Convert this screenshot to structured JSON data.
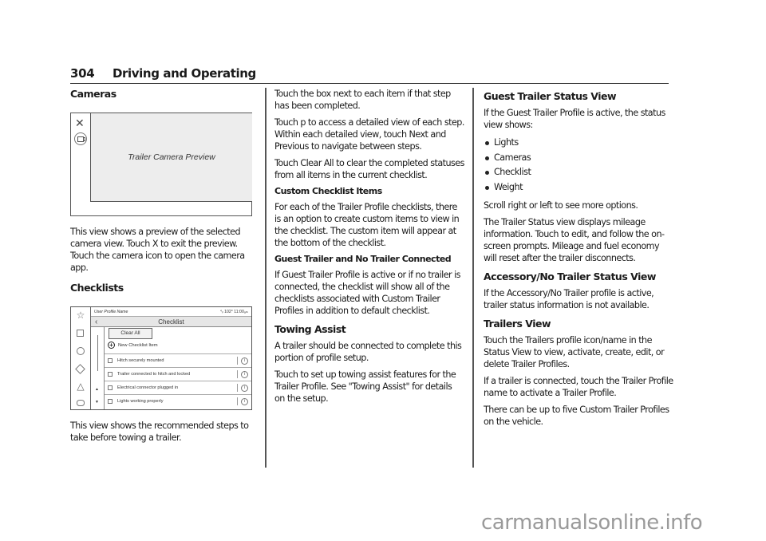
{
  "header": {
    "page_number": "304",
    "section": "Driving and Operating"
  },
  "column1": {
    "cameras_heading": "Cameras",
    "camera_figure": {
      "close_icon": "✕",
      "preview_label": "Trailer Camera Preview"
    },
    "cameras_text": "This view shows a preview of the selected camera view. Touch X to exit the preview. Touch the camera icon to open the camera app.",
    "checklists_heading": "Checklists",
    "checklist_figure": {
      "profile_name": "User Profile Name",
      "status": "⁴ᵢₗ  102°  11:00ₐₘ",
      "back_icon": "‹",
      "title": "Checklist",
      "clear_all": "Clear All",
      "new_item": "New Checklist Item",
      "items": [
        "Hitch securely mounted",
        "Trailer connected to hitch and locked",
        "Electrical connector plugged in",
        "Lights working properly"
      ],
      "side_icons": [
        "star-icon",
        "square-icon",
        "circle-icon",
        "diamond-icon",
        "triangle-icon",
        "hexagon-icon"
      ]
    },
    "checklists_text": "This view shows the recommended steps to take before towing a trailer."
  },
  "column2": {
    "p1": "Touch the box next to each item if that step has been completed.",
    "p2": "Touch p to access a detailed view of each step. Within each detailed view, touch Next and Previous to navigate between steps.",
    "p3": "Touch Clear All to clear the completed statuses from all items in the current checklist.",
    "custom_heading": "Custom Checklist Items",
    "custom_text": "For each of the Trailer Profile checklists, there is an option to create custom items to view in the checklist. The custom item will appear at the bottom of the checklist.",
    "guest_heading": "Guest Trailer and No Trailer Connected",
    "guest_text": "If Guest Trailer Profile is active or if no trailer is connected, the checklist will show all of the checklists associated with Custom Trailer Profiles in addition to default checklist.",
    "towing_heading": "Towing Assist",
    "towing_p1": "A trailer should be connected to complete this portion of profile setup.",
    "towing_p2": "Touch to set up towing assist features for the Trailer Profile. See \"Towing Assist\" for details on the setup."
  },
  "column3": {
    "guest_status_heading": "Guest Trailer Status View",
    "guest_status_text": "If the Guest Trailer Profile is active, the status view shows:",
    "bullets": [
      "Lights",
      "Cameras",
      "Checklist",
      "Weight"
    ],
    "scroll_text": "Scroll right or left to see more options.",
    "mileage_text": "The Trailer Status view displays mileage information. Touch to edit, and follow the on-screen prompts. Mileage and fuel economy will reset after the trailer disconnects.",
    "accessory_heading": "Accessory/No Trailer Status View",
    "accessory_text": "If the Accessory/No Trailer profile is active, trailer status information is not available.",
    "trailers_heading": "Trailers View",
    "trailers_p1": "Touch the Trailers profile icon/name in the Status View to view, activate, create, edit, or delete Trailer Profiles.",
    "trailers_p2": "If a trailer is connected, touch the Trailer Profile name to activate a Trailer Profile.",
    "trailers_p3": "There can be up to five Custom Trailer Profiles on the vehicle."
  },
  "watermark": "carmanualsonline.info"
}
